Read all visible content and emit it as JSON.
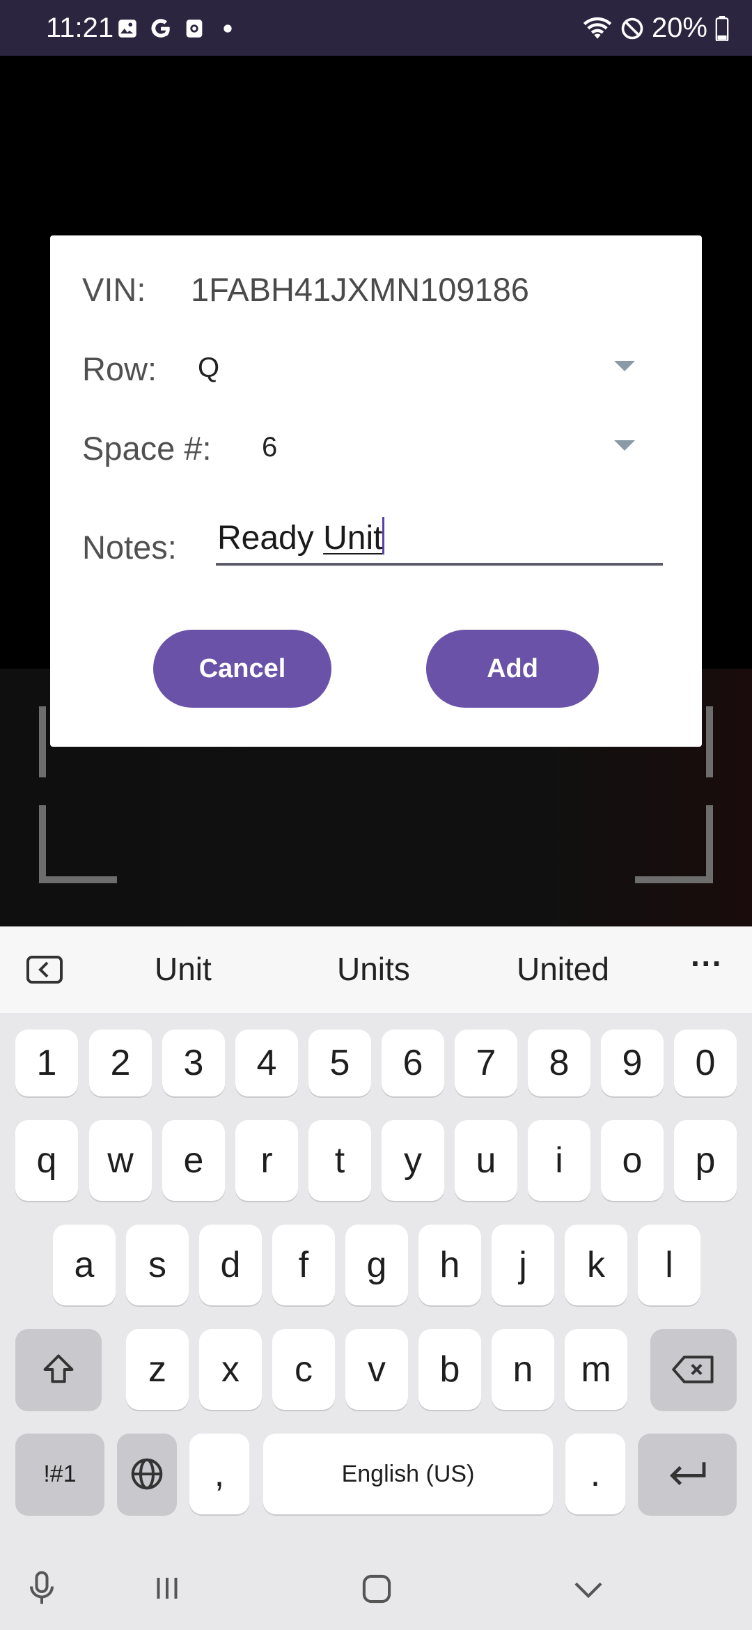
{
  "status_bar": {
    "time": "11:21",
    "battery": "20%",
    "left_icons": [
      "gallery-icon",
      "google-icon",
      "screen-record-icon",
      "dot-icon"
    ],
    "right_icons": [
      "wifi-icon",
      "do-not-disturb-icon",
      "battery-icon"
    ]
  },
  "dialog": {
    "vin_label": "VIN:",
    "vin_value": "1FABH41JXMN109186",
    "row_label": "Row:",
    "row_value": "Q",
    "space_label": "Space #:",
    "space_value": "6",
    "notes_label": "Notes:",
    "notes_value_prefix": "Ready ",
    "notes_value_composing": "Unit",
    "cancel_label": "Cancel",
    "add_label": "Add",
    "accent_color": "#6a52a8"
  },
  "keyboard": {
    "suggestions": [
      "Unit",
      "Units",
      "United"
    ],
    "more_label": "···",
    "number_row": [
      "1",
      "2",
      "3",
      "4",
      "5",
      "6",
      "7",
      "8",
      "9",
      "0"
    ],
    "row1": [
      "q",
      "w",
      "e",
      "r",
      "t",
      "y",
      "u",
      "i",
      "o",
      "p"
    ],
    "row2": [
      "a",
      "s",
      "d",
      "f",
      "g",
      "h",
      "j",
      "k",
      "l"
    ],
    "row3": [
      "z",
      "x",
      "c",
      "v",
      "b",
      "n",
      "m"
    ],
    "symbols_label": "!#1",
    "comma_label": ",",
    "space_label": "English (US)",
    "period_label": "."
  }
}
